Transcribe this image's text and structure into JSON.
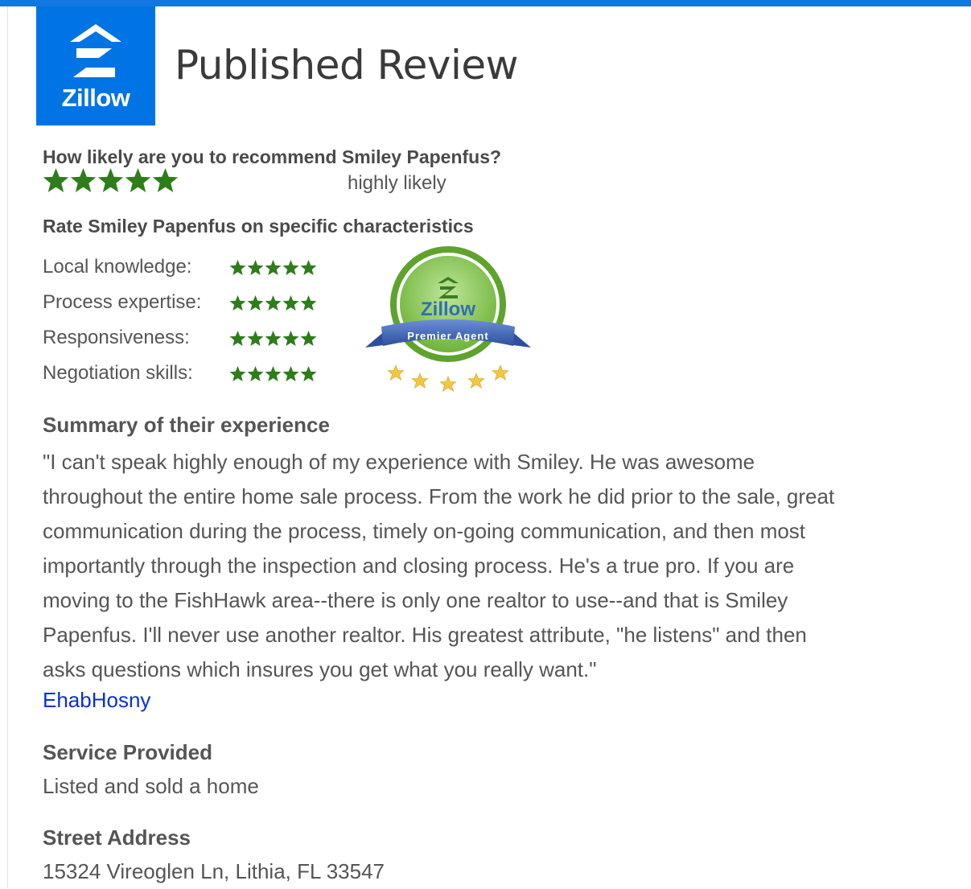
{
  "header": {
    "logo_text": "Zillow",
    "title": "Published Review",
    "accent_color": "#0074e4"
  },
  "recommend": {
    "question": "How likely are you to recommend Smiley Papenfus?",
    "stars": 5,
    "answer": "highly likely",
    "star_color": "#2e7d1a"
  },
  "characteristics": {
    "heading": "Rate Smiley Papenfus on specific characteristics",
    "items": [
      {
        "label": "Local knowledge:",
        "stars": 5
      },
      {
        "label": "Process expertise:",
        "stars": 5
      },
      {
        "label": "Responsiveness:",
        "stars": 5
      },
      {
        "label": "Negotiation skills:",
        "stars": 5
      }
    ]
  },
  "badge": {
    "brand": "Zillow",
    "ribbon": "Premier Agent"
  },
  "summary": {
    "heading": "Summary of their experience",
    "lines": [
      "\"I can't speak highly enough of my experience with Smiley.  He was awesome",
      "throughout the entire home sale process.  From the work he did prior to the sale, great",
      "communication during the process, timely on-going communication, and then most",
      "importantly through the inspection and closing process.  He's a true pro.  If you are",
      "moving to the FishHawk area--there is only one realtor to use--and that is Smiley",
      "Papenfus.  I'll never use  another realtor.  His greatest attribute, \"he listens\" and then",
      "asks questions which insures you get what you really want.\""
    ],
    "reviewer": "EhabHosny"
  },
  "service": {
    "heading": "Service Provided",
    "value": "Listed and sold a home"
  },
  "address": {
    "heading": "Street Address",
    "value": "15324 Vireoglen Ln, Lithia, FL 33547"
  }
}
